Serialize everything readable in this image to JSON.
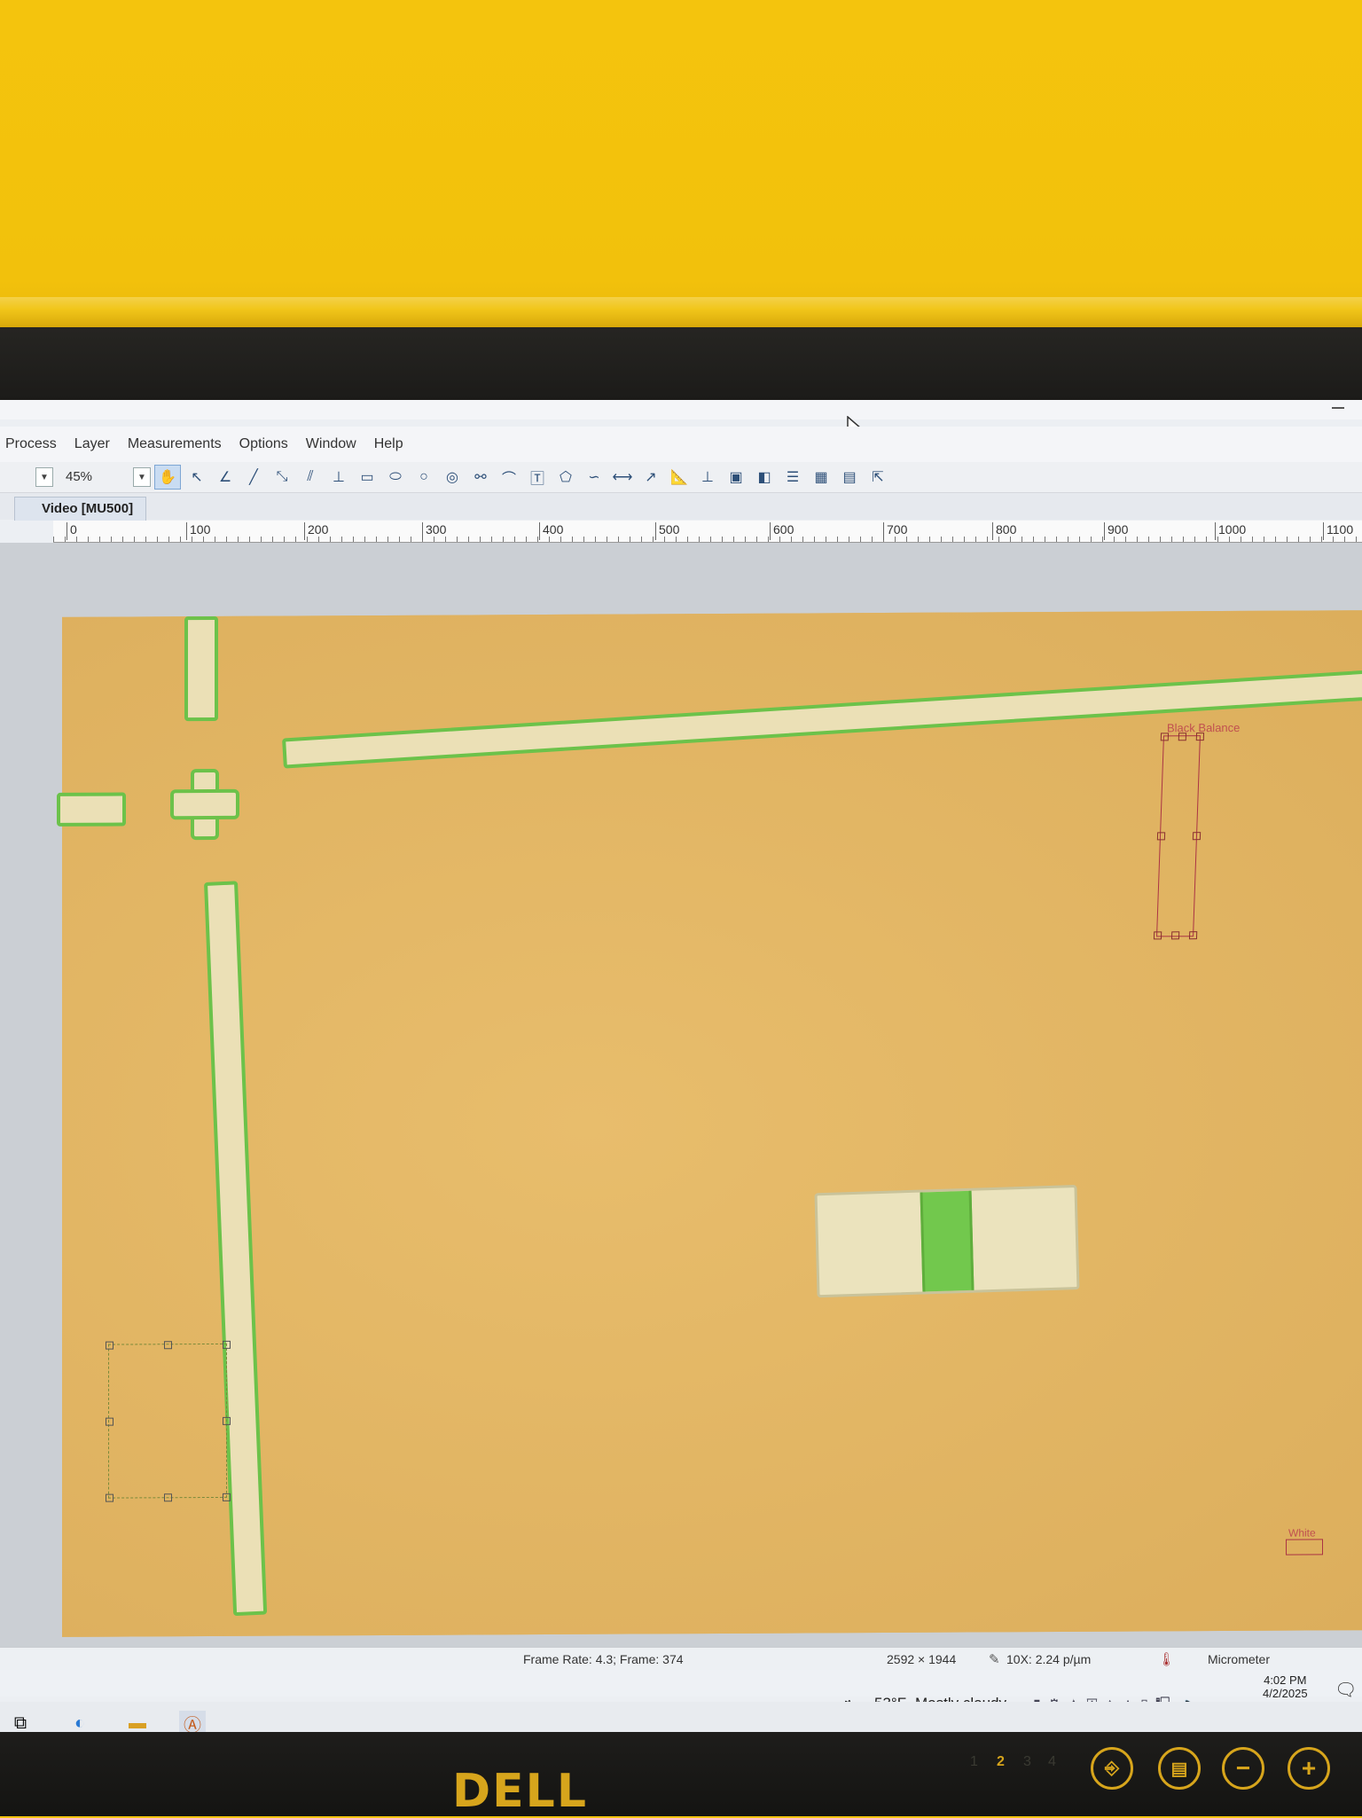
{
  "menu": [
    "Process",
    "Layer",
    "Measurements",
    "Options",
    "Window",
    "Help"
  ],
  "toolbar": {
    "zoom": "45%"
  },
  "tab": {
    "label": "Video [MU500]"
  },
  "ruler": [
    "0",
    "100",
    "200",
    "300",
    "400",
    "500",
    "600",
    "700",
    "800",
    "900",
    "1000",
    "1100"
  ],
  "rois": {
    "black_balance": "Black Balance",
    "white": "White"
  },
  "status": {
    "frame": "Frame Rate: 4.3; Frame: 374",
    "resolution": "2592 × 1944",
    "calibration": "10X: 2.24 p/µm",
    "unit": "Micrometer"
  },
  "tray": {
    "weather_temp": "53°F",
    "weather_text": "Mostly cloudy",
    "time": "4:02 PM",
    "date": "4/2/2025"
  },
  "monitor": {
    "brand": "DELL",
    "input_numbers": [
      "1",
      "2",
      "3",
      "4"
    ]
  }
}
